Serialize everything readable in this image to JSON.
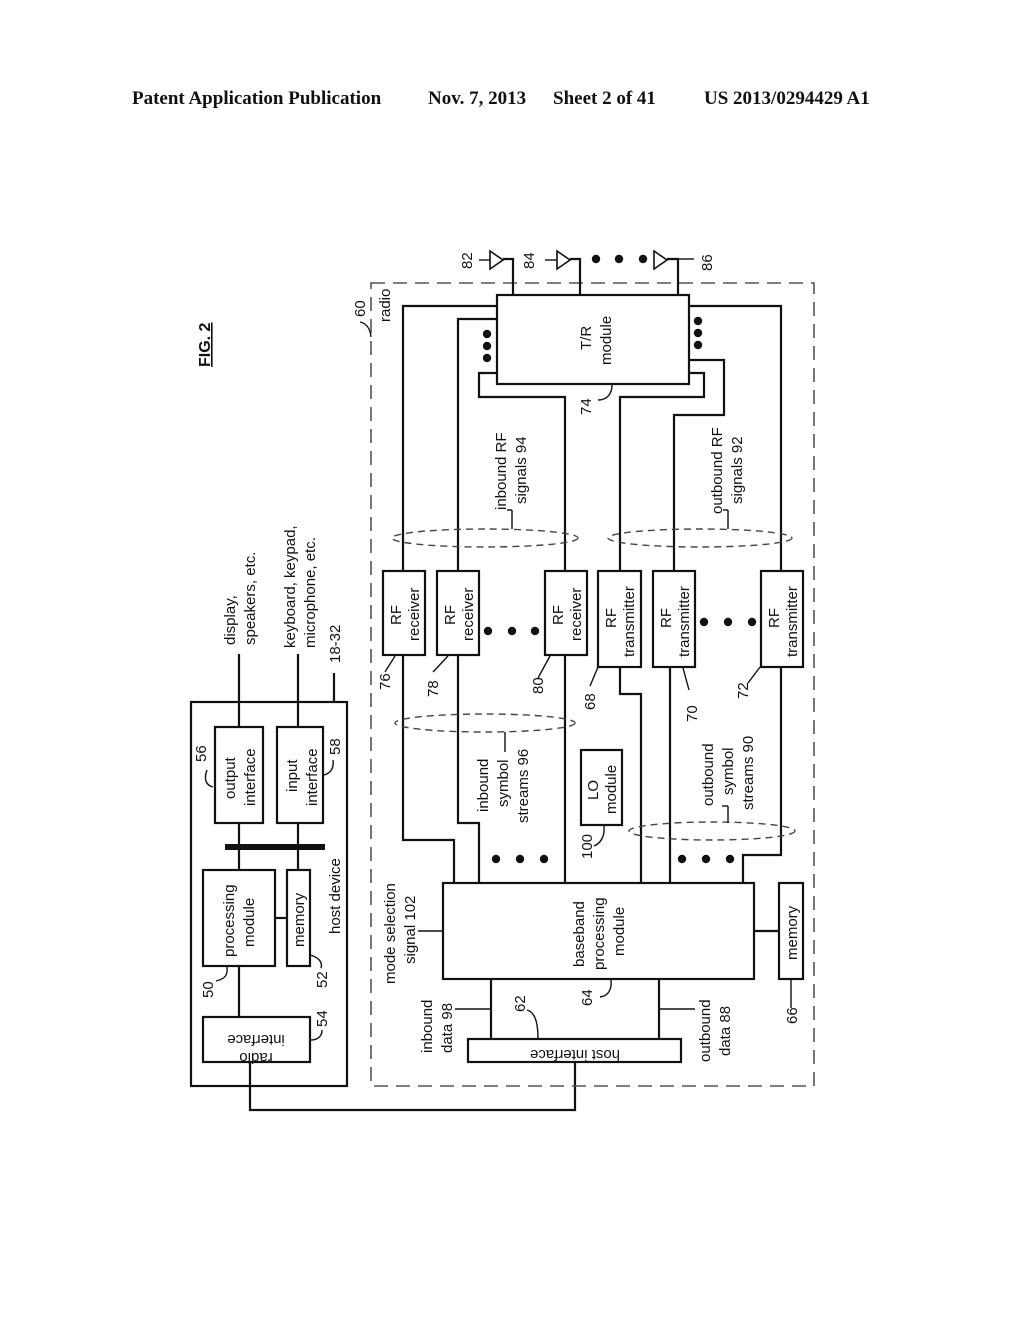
{
  "header": {
    "publication": "Patent Application Publication",
    "date": "Nov. 7, 2013",
    "sheet": "Sheet 2 of 41",
    "number": "US 2013/0294429 A1"
  },
  "figure": {
    "title": "FIG. 2",
    "host": {
      "label": "host device",
      "ref": "18-32",
      "processing_module": [
        "processing",
        "module"
      ],
      "processing_ref": "50",
      "memory": "memory",
      "memory_ref": "52",
      "radio_interface": [
        "radio",
        "interface"
      ],
      "radio_interface_ref": "54",
      "output_interface": [
        "output",
        "interface"
      ],
      "output_ref": "56",
      "input_interface": [
        "input",
        "interface"
      ],
      "input_ref": "58",
      "output_devices": [
        "display,",
        "speakers, etc."
      ],
      "input_devices": [
        "keyboard, keypad,",
        "microphone, etc."
      ]
    },
    "radio": {
      "label": "radio",
      "ref": "60",
      "host_interface": "host interface",
      "host_interface_ref": "62",
      "baseband": [
        "baseband",
        "processing",
        "module"
      ],
      "baseband_ref": "64",
      "memory": "memory",
      "memory_ref": "66",
      "tr_module": [
        "T/R",
        "module"
      ],
      "tr_ref": "74",
      "lo_module": [
        "LO",
        "module"
      ],
      "lo_ref": "100",
      "receivers": [
        {
          "label": [
            "RF",
            "receiver"
          ],
          "ref": "76"
        },
        {
          "label": [
            "RF",
            "receiver"
          ],
          "ref": "78"
        },
        {
          "label": [
            "RF",
            "receiver"
          ],
          "ref": "80"
        }
      ],
      "transmitters": [
        {
          "label": [
            "RF",
            "transmitter"
          ],
          "ref": "68"
        },
        {
          "label": [
            "RF",
            "transmitter"
          ],
          "ref": "70"
        },
        {
          "label": [
            "RF",
            "transmitter"
          ],
          "ref": "72"
        }
      ],
      "antennas": [
        "82",
        "84",
        "86"
      ],
      "inbound_rf": [
        "inbound RF",
        "signals 94"
      ],
      "outbound_rf": [
        "outbound RF",
        "signals 92"
      ],
      "inbound_symbol": [
        "inbound",
        "symbol",
        "streams 96"
      ],
      "outbound_symbol": [
        "outbound",
        "symbol",
        "streams 90"
      ],
      "inbound_data": [
        "inbound",
        "data 98"
      ],
      "outbound_data": [
        "outbound",
        "data 88"
      ],
      "mode_selection": [
        "mode selection",
        "signal 102"
      ]
    }
  }
}
